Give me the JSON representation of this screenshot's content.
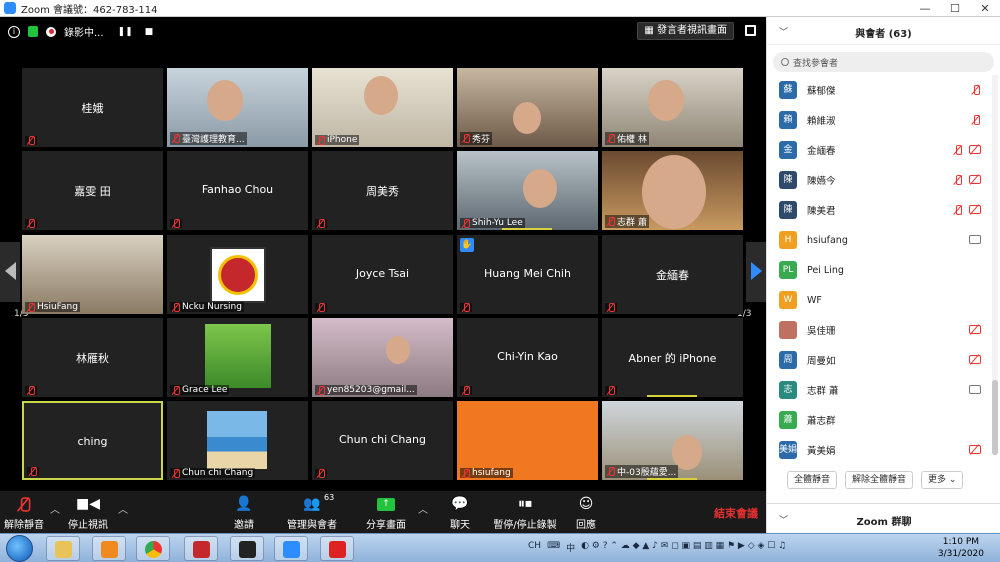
{
  "window": {
    "title": "Zoom 會議號：462-783-114"
  },
  "topbar": {
    "recording": "錄影中...",
    "speaker_view": "發言者視訊畫面"
  },
  "tiles": [
    {
      "label": "桂娥",
      "center": true
    },
    {
      "label": "臺灣護理教育..."
    },
    {
      "label": "iPhone"
    },
    {
      "label": "秀芬"
    },
    {
      "label": "佑權 林"
    },
    {
      "label": "嘉雯 田",
      "center": true
    },
    {
      "label": "Fanhao Chou",
      "center": true
    },
    {
      "label": "周美秀",
      "center": true
    },
    {
      "label": "Shih-Yu Lee"
    },
    {
      "label": "志群 蕭"
    },
    {
      "label": "HsiuFang"
    },
    {
      "label": "Ncku Nursing"
    },
    {
      "label": "Joyce Tsai",
      "center": true
    },
    {
      "label": "Huang Mei Chih",
      "center": true
    },
    {
      "label": "金緬春",
      "center": true
    },
    {
      "label": "林雁秋",
      "center": true
    },
    {
      "label": "Grace Lee"
    },
    {
      "label": "yen85203@gmail..."
    },
    {
      "label": "Chi-Yin Kao",
      "center": true
    },
    {
      "label": "Abner 的 iPhone",
      "center": true
    },
    {
      "label": "ching",
      "center": true
    },
    {
      "label": "Chun chi Chang"
    },
    {
      "label": "Chun chi Chang",
      "center": true
    },
    {
      "label": "hsiufang"
    },
    {
      "label": "中-03殷蘊愛..."
    }
  ],
  "pagination": {
    "left": "1/3",
    "right": "1/3"
  },
  "toolbar": {
    "unmute": "解除靜音",
    "stop_video": "停止視訊",
    "invite": "邀請",
    "manage": "管理與會者",
    "participant_count": "63",
    "share": "分享畫面",
    "chat": "聊天",
    "pause_record": "暫停/停止錄製",
    "reactions": "回應",
    "end": "結束會議"
  },
  "panel": {
    "title": "與會者 (63)",
    "search_placeholder": "查找參會者",
    "participants": [
      {
        "initial": "蘇",
        "name": "蘇郁傑",
        "color": "#2d6aa8",
        "mic": "muted"
      },
      {
        "initial": "賴",
        "name": "賴維淑",
        "color": "#2d6aa8",
        "mic": "muted"
      },
      {
        "initial": "金",
        "name": "金緬春",
        "color": "#2d6aa8",
        "mic": "muted",
        "cam": "off"
      },
      {
        "initial": "陳",
        "name": "陳嬿今",
        "color": "#2d4a6a",
        "mic": "muted",
        "cam": "off"
      },
      {
        "initial": "陳",
        "name": "陳美君",
        "color": "#2d4a6a",
        "mic": "muted",
        "cam": "off"
      },
      {
        "initial": "H",
        "name": "hsiufang",
        "color": "#f0a020",
        "cam": "on"
      },
      {
        "initial": "PL",
        "name": "Pei Ling",
        "color": "#3aaa50"
      },
      {
        "initial": "W",
        "name": "WF",
        "color": "#f0a020"
      },
      {
        "initial": "",
        "name": "吳佳珊",
        "color": "#c07060",
        "cam": "off"
      },
      {
        "initial": "周",
        "name": "周曼如",
        "color": "#2d6aa8",
        "cam": "off"
      },
      {
        "initial": "志",
        "name": "志群 蕭",
        "color": "#2a8a80",
        "cam": "on"
      },
      {
        "initial": "蕭",
        "name": "蕭志群",
        "color": "#3aaa50"
      },
      {
        "initial": "美娟",
        "name": "黃美娟",
        "color": "#2d6aa8",
        "cam": "off"
      }
    ],
    "mute_all": "全體靜音",
    "unmute_all": "解除全體靜音",
    "more": "更多",
    "chat_title": "Zoom 群聊"
  },
  "taskbar": {
    "time": "1:10 PM",
    "date": "3/31/2020",
    "ime": "CH",
    "ime2": "中"
  }
}
